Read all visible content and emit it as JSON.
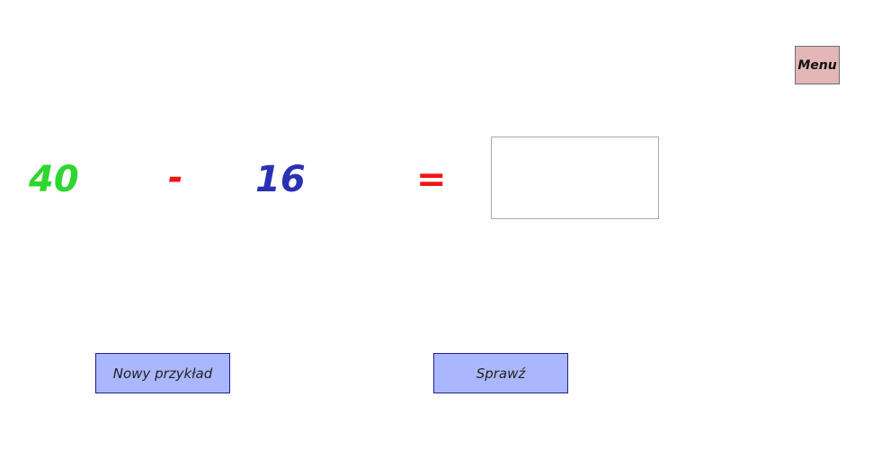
{
  "menu": {
    "label": "Menu"
  },
  "equation": {
    "operand_a": "40",
    "operator": "-",
    "operand_b": "16",
    "equals": "="
  },
  "answer": {
    "value": "",
    "placeholder": ""
  },
  "buttons": {
    "new_example": "Nowy przykład",
    "check": "Sprawź"
  },
  "colors": {
    "operand_a": "#2ed62e",
    "operator": "#ee1616",
    "operand_b": "#2b31b3",
    "menu_bg": "#e3b7b7",
    "button_bg": "#aab7ff"
  }
}
